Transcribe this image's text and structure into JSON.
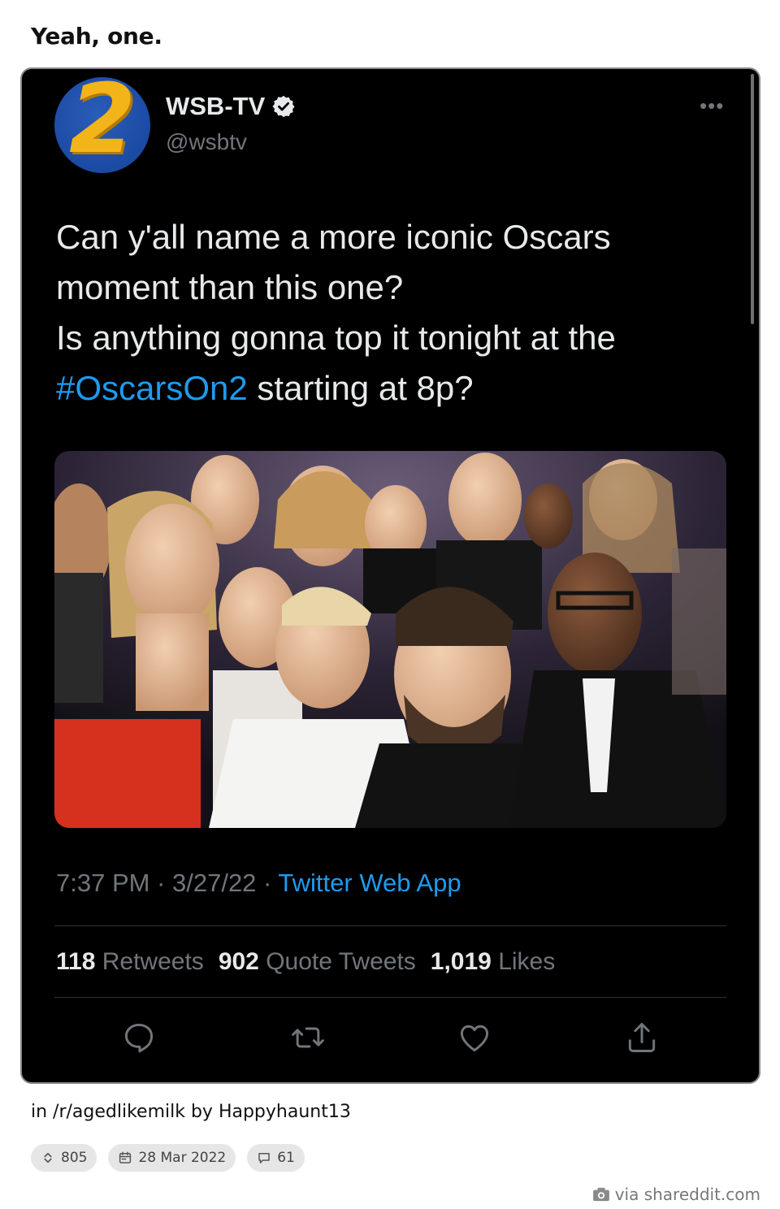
{
  "post": {
    "title": "Yeah, one.",
    "subreddit_line": "in /r/agedlikemilk by Happyhaunt13",
    "score": "805",
    "date": "28 Mar 2022",
    "comments": "61",
    "via": "via shareddit.com"
  },
  "tweet": {
    "avatar_text": "2",
    "display_name": "WSB-TV",
    "handle": "@wsbtv",
    "more": "•••",
    "text_line1": "Can y'all name a more iconic Oscars",
    "text_line2": "moment than this one?",
    "text_line3": "Is anything gonna top it tonight at the",
    "hashtag": "#OscarsOn2",
    "text_line4_rest": " starting at 8p?",
    "time_date": "7:37 PM · 3/27/22 · ",
    "app": "Twitter Web App",
    "retweets_count": "118",
    "retweets_label": "Retweets",
    "quotes_count": "902",
    "quotes_label": "Quote Tweets",
    "likes_count": "1,019",
    "likes_label": "Likes"
  },
  "colors": {
    "tweet_bg": "#000000",
    "accent": "#1d9bf0",
    "muted": "#71767b",
    "text": "#e7e9ea"
  }
}
